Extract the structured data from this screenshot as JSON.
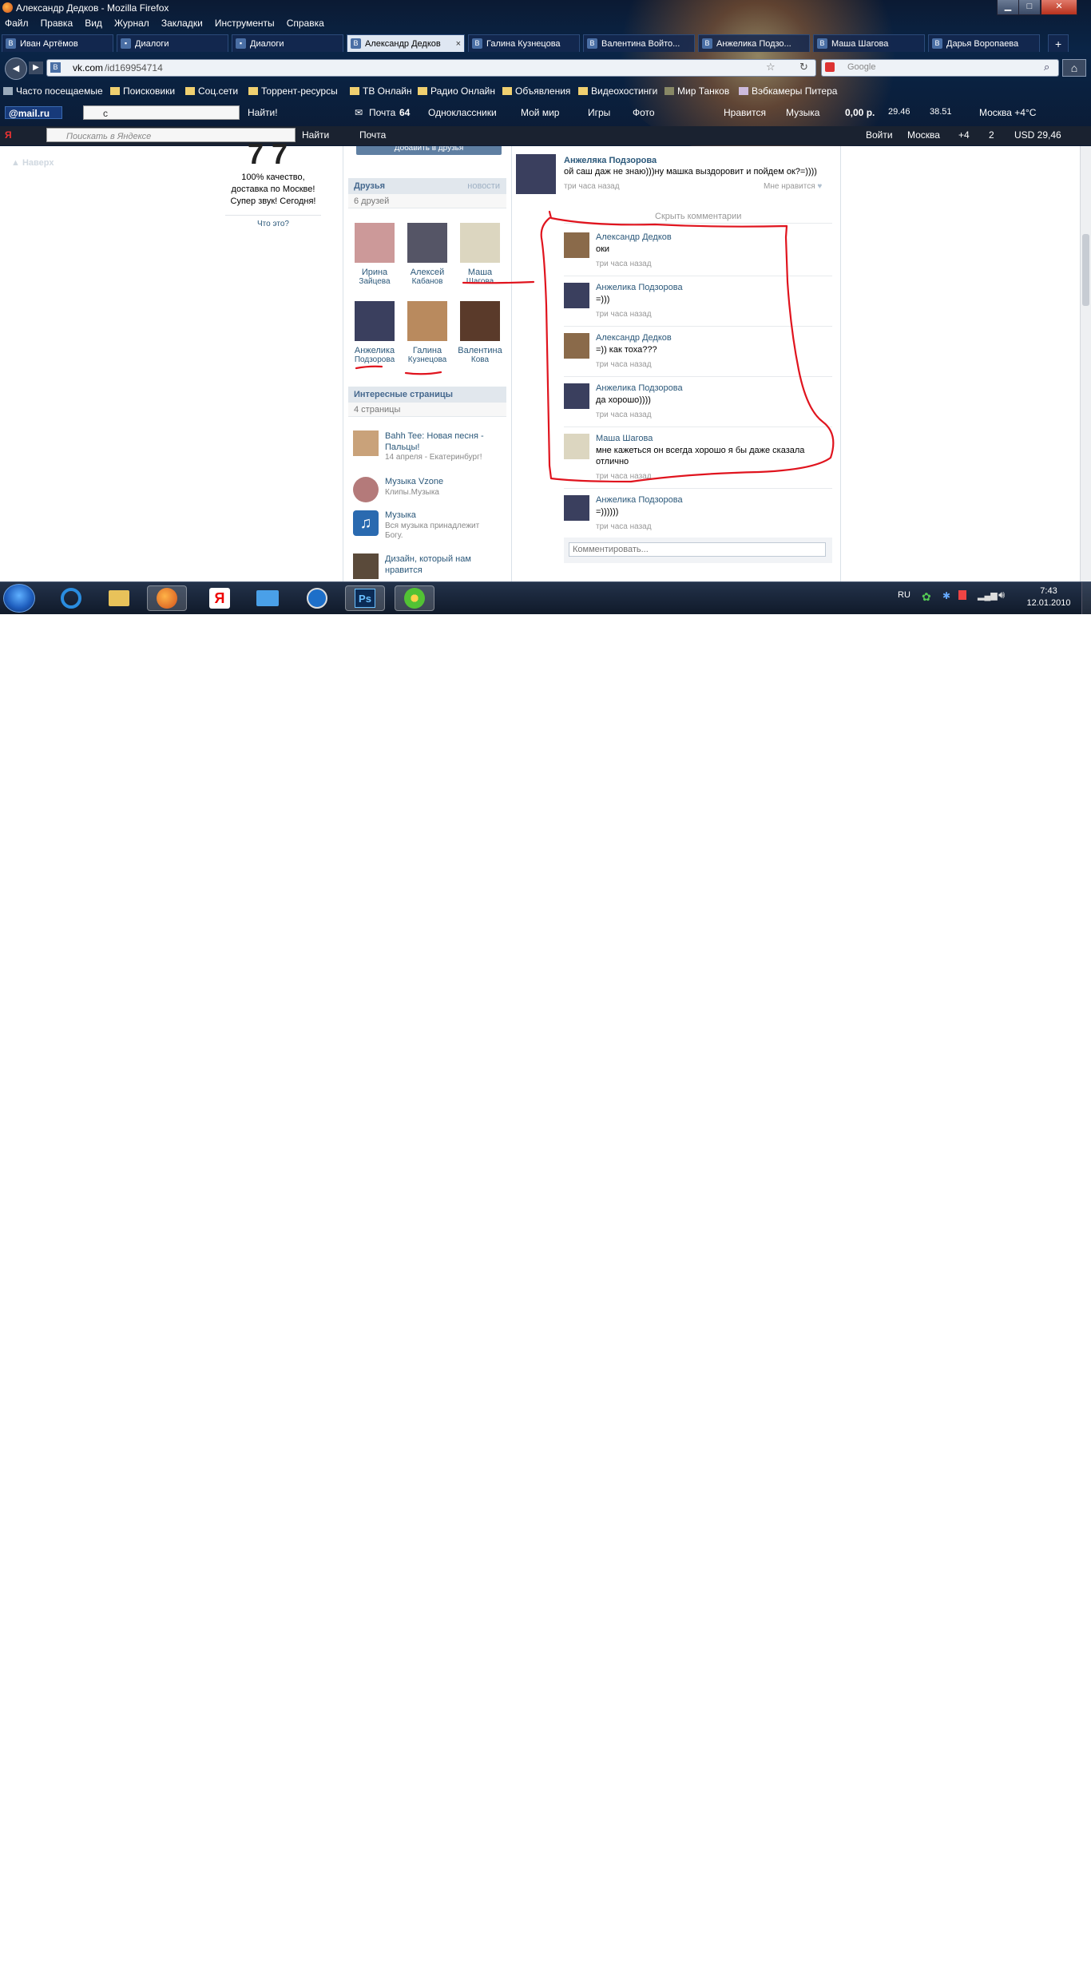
{
  "window": {
    "title": "Александр Дедков - Mozilla Firefox",
    "minimize": "▁",
    "maximize": "□",
    "close": "✕"
  },
  "menu": [
    "Файл",
    "Правка",
    "Вид",
    "Журнал",
    "Закладки",
    "Инструменты",
    "Справка"
  ],
  "tabs": [
    {
      "label": "Иван Артёмов",
      "active": false
    },
    {
      "label": "Диалоги",
      "active": false
    },
    {
      "label": "Диалоги",
      "active": false
    },
    {
      "label": "Александр Дедков",
      "active": true
    },
    {
      "label": "Галина Кузнецова",
      "active": false
    },
    {
      "label": "Валентина Войто...",
      "active": false
    },
    {
      "label": "Анжелика Подзо...",
      "active": false
    },
    {
      "label": "Маша Шагова",
      "active": false
    },
    {
      "label": "Дарья Воропаева",
      "active": false
    }
  ],
  "tab_close": "×",
  "new_tab": "+",
  "nav": {
    "url_domain": "vk.com",
    "url_path": "/id169954714",
    "search_placeholder": "Google",
    "back": "◀",
    "forward": "▶",
    "reload": "↻",
    "home": "⌂"
  },
  "bookmarks": [
    "Часто посещаемые",
    "Поисковики",
    "Соц.сети",
    "Торрент-ресурсы",
    "ТВ Онлайн",
    "Радио Онлайн",
    "Объявления",
    "Видеохостинги",
    "Мир Танков",
    "Вэбкамеры Питера"
  ],
  "toolbar_mail": {
    "logo": "@mail.ru",
    "query": "с",
    "find": "Найти!",
    "items": [
      "Почта",
      "64",
      "Одноклассники",
      "Мой мир",
      "Игры",
      "Фото",
      "Нравится",
      "Музыка",
      "0,00 р.",
      "29.46",
      "38.51",
      "Москва +4°C"
    ]
  },
  "toolbar_yandex": {
    "placeholder": "Поискать в Яндексе",
    "find": "Найти",
    "mail": "Почта",
    "login": "Войти",
    "city": "Москва",
    "weather": "+4",
    "count": "2",
    "usd": "USD 29,46"
  },
  "left_col": {
    "ad_text": "100% качество, доставка по Москве! Супер звук! Сегодня!",
    "ad_link": "Что это?",
    "news_link": "Наверх"
  },
  "friends": {
    "header": "Друзья",
    "header_link": "новости",
    "count": "6 друзей",
    "add_button": "Добавить в друзья",
    "list": [
      {
        "first": "Ирина",
        "last": "Зайцева",
        "color": "#c99"
      },
      {
        "first": "Алексей",
        "last": "Кабанов",
        "color": "#556"
      },
      {
        "first": "Маша",
        "last": "Шагова",
        "color": "#dcd6c0"
      },
      {
        "first": "Анжелика",
        "last": "Подзорова",
        "color": "#3a3f5e"
      },
      {
        "first": "Галина",
        "last": "Кузнецова",
        "color": "#b98a5e"
      },
      {
        "first": "Валентина",
        "last": "Кова",
        "color": "#5a3a2a"
      }
    ]
  },
  "pages": {
    "header": "Интересные страницы",
    "count": "4 страницы",
    "list": [
      {
        "title": "Bahh Tee: Новая песня - Пальцы!",
        "desc": "14 апреля - Екатеринбург!",
        "color": "#c9a27a"
      },
      {
        "title": "Музыка Vzone",
        "desc": "Клипы.Музыка",
        "color": "#b47a7a"
      },
      {
        "title": "Музыка",
        "desc": "Вся музыка принадлежит Богу.",
        "color": "#2a6ab0"
      },
      {
        "title": "Дизайн, который нам нравится",
        "desc": "",
        "color": "#5a4a3a"
      }
    ]
  },
  "post": {
    "author": "Анжеляка Подзорова",
    "text": "ой саш даж не знаю)))ну машка выздоровит и пойдем ок?=))))",
    "time": "три часа назад",
    "like": "Мне нравится",
    "hide_comments": "Скрыть комментарии"
  },
  "comments": [
    {
      "name": "Александр Дедков",
      "text": "оки",
      "time": "три часа назад",
      "color": "#8a6a4a"
    },
    {
      "name": "Анжелика Подзорова",
      "text": "=)))",
      "time": "три часа назад",
      "color": "#3a3f5e"
    },
    {
      "name": "Александр Дедков",
      "text": "=)) как тоха???",
      "time": "три часа назад",
      "color": "#8a6a4a"
    },
    {
      "name": "Анжелика Подзорова",
      "text": "да хорошо))))",
      "time": "три часа назад",
      "color": "#3a3f5e"
    },
    {
      "name": "Маша Шагова",
      "text": "мне кажеться он всегда хорошо я бы даже сказала отлично",
      "time": "три часа назад",
      "color": "#dcd6c0"
    },
    {
      "name": "Анжелика Подзорова",
      "text": "=))))))",
      "time": "три часа назад",
      "color": "#3a3f5e"
    }
  ],
  "comment_input_placeholder": "Комментировать...",
  "taskbar": {
    "lang": "RU",
    "time": "7:43",
    "date": "12.01.2010"
  },
  "colors": {
    "vk_blue": "#2b587a",
    "annotation_red": "#e0141e"
  }
}
